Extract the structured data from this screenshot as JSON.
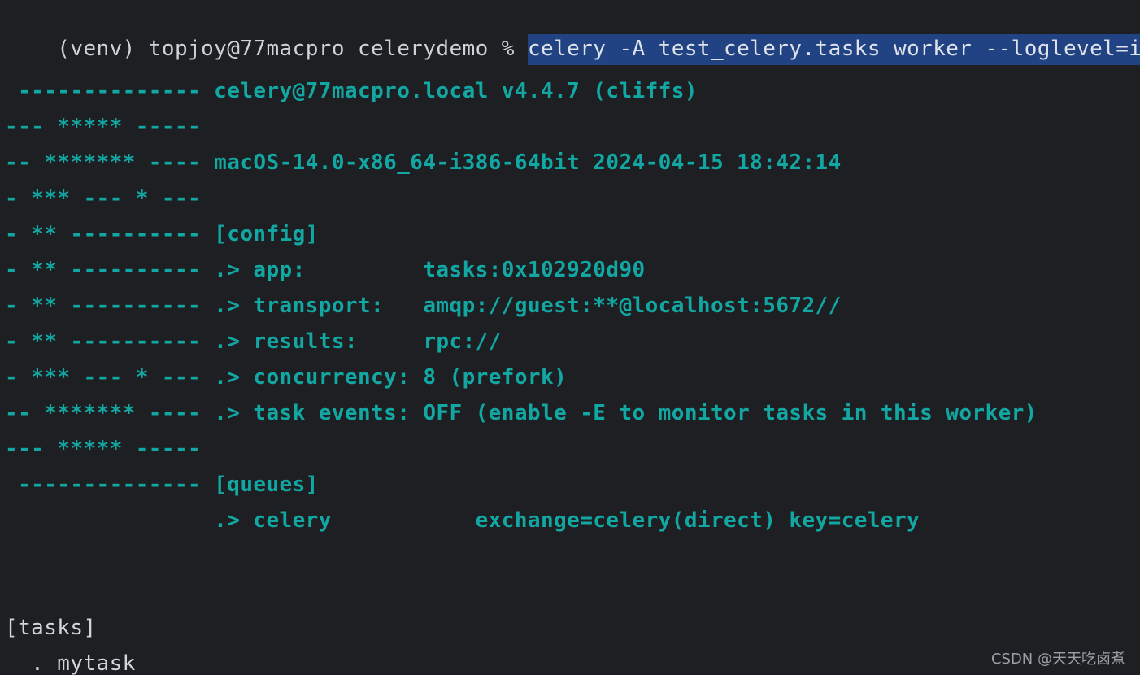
{
  "prompt": {
    "prefix": "(venv) topjoy@77macpro celerydemo % ",
    "command": "celery -A test_celery.tasks worker --loglevel=info"
  },
  "banner": [
    " -------------- celery@77macpro.local v4.4.7 (cliffs)",
    "--- ***** -----",
    "-- ******* ---- macOS-14.0-x86_64-i386-64bit 2024-04-15 18:42:14",
    "- *** --- * ---",
    "- ** ---------- [config]",
    "- ** ---------- .> app:         tasks:0x102920d90",
    "- ** ---------- .> transport:   amqp://guest:**@localhost:5672//",
    "- ** ---------- .> results:     rpc://",
    "- *** --- * --- .> concurrency: 8 (prefork)",
    "-- ******* ---- .> task events: OFF (enable -E to monitor tasks in this worker)",
    "--- ***** -----",
    " -------------- [queues]",
    "                .> celery           exchange=celery(direct) key=celery"
  ],
  "tasks": {
    "header": "[tasks]",
    "items": [
      "  . mytask"
    ]
  },
  "watermark": "CSDN @天天吃卤煮",
  "colors": {
    "background": "#1e1f22",
    "banner_teal": "#12a7a2",
    "selection": "#214283",
    "text": "#cfd3d8"
  }
}
